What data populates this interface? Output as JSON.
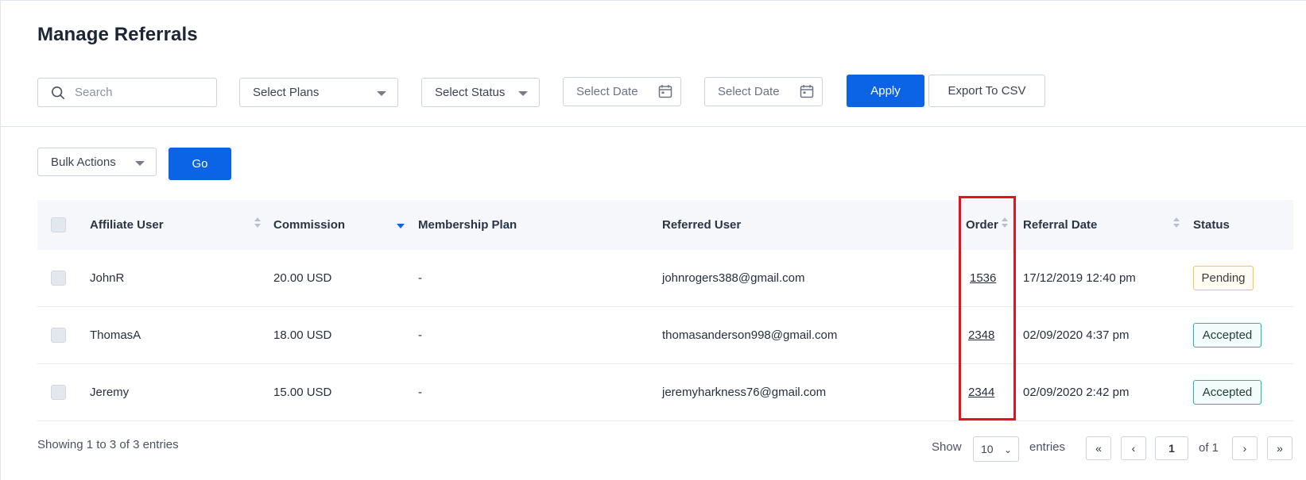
{
  "page": {
    "title": "Manage Referrals"
  },
  "filters": {
    "search_placeholder": "Search",
    "plans_label": "Select Plans",
    "status_label": "Select Status",
    "date_from_label": "Select Date",
    "date_to_label": "Select Date",
    "apply_label": "Apply",
    "export_label": "Export To CSV"
  },
  "bulk": {
    "label": "Bulk Actions",
    "go_label": "Go"
  },
  "table": {
    "columns": {
      "affiliate_user": "Affiliate User",
      "commission": "Commission",
      "membership_plan": "Membership Plan",
      "referred_user": "Referred User",
      "order": "Order",
      "referral_date": "Referral Date",
      "status": "Status"
    },
    "rows": [
      {
        "affiliate_user": "JohnR",
        "commission": "20.00 USD",
        "membership_plan": "-",
        "referred_user": "johnrogers388@gmail.com",
        "order": "1536",
        "referral_date": "17/12/2019 12:40 pm",
        "status": "Pending"
      },
      {
        "affiliate_user": "ThomasA",
        "commission": "18.00 USD",
        "membership_plan": "-",
        "referred_user": "thomasanderson998@gmail.com",
        "order": "2348",
        "referral_date": "02/09/2020 4:37 pm",
        "status": "Accepted"
      },
      {
        "affiliate_user": "Jeremy",
        "commission": "15.00 USD",
        "membership_plan": "-",
        "referred_user": "jeremyharkness76@gmail.com",
        "order": "2344",
        "referral_date": "02/09/2020 2:42 pm",
        "status": "Accepted"
      }
    ]
  },
  "footer": {
    "showing": "Showing 1 to 3 of 3 entries",
    "show_label": "Show",
    "per_page": "10",
    "entries_label": "entries",
    "first": "«",
    "prev": "‹",
    "current_page": "1",
    "of_label": "of 1",
    "next": "›",
    "last": "»"
  },
  "colors": {
    "primary": "#0b63e5",
    "highlight": "#e5131f",
    "pending_border": "#f2c94c",
    "accepted_border": "#1cbfa6"
  }
}
